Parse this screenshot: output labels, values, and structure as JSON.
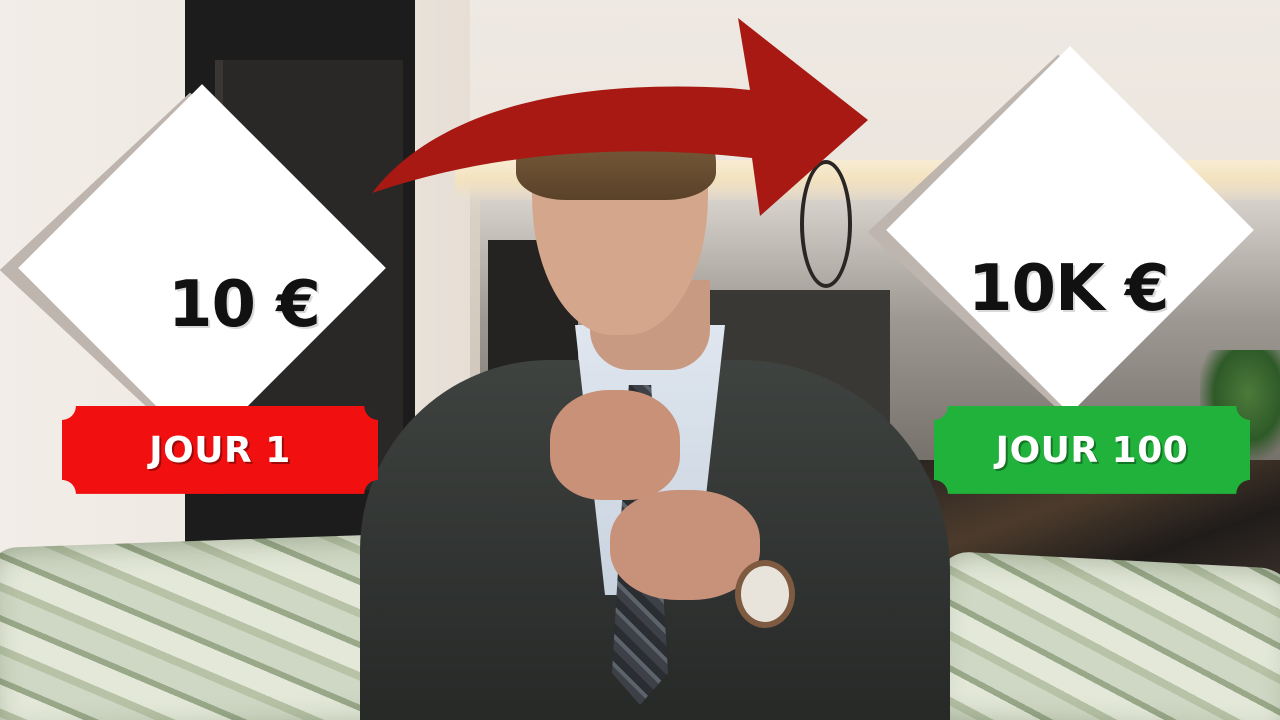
{
  "left_card": {
    "price": "10 €",
    "label": "JOUR 1"
  },
  "right_card": {
    "price": "10K €",
    "label": "JOUR 100"
  },
  "colors": {
    "arrow": "#a71912",
    "left_ticket": "#f20f0f",
    "right_ticket": "#20b23a",
    "card": "#ffffff",
    "card_shadow": "#bdb5ae",
    "price_text": "#111111"
  },
  "icons": {
    "arrow": "curved-arrow-right-icon"
  }
}
